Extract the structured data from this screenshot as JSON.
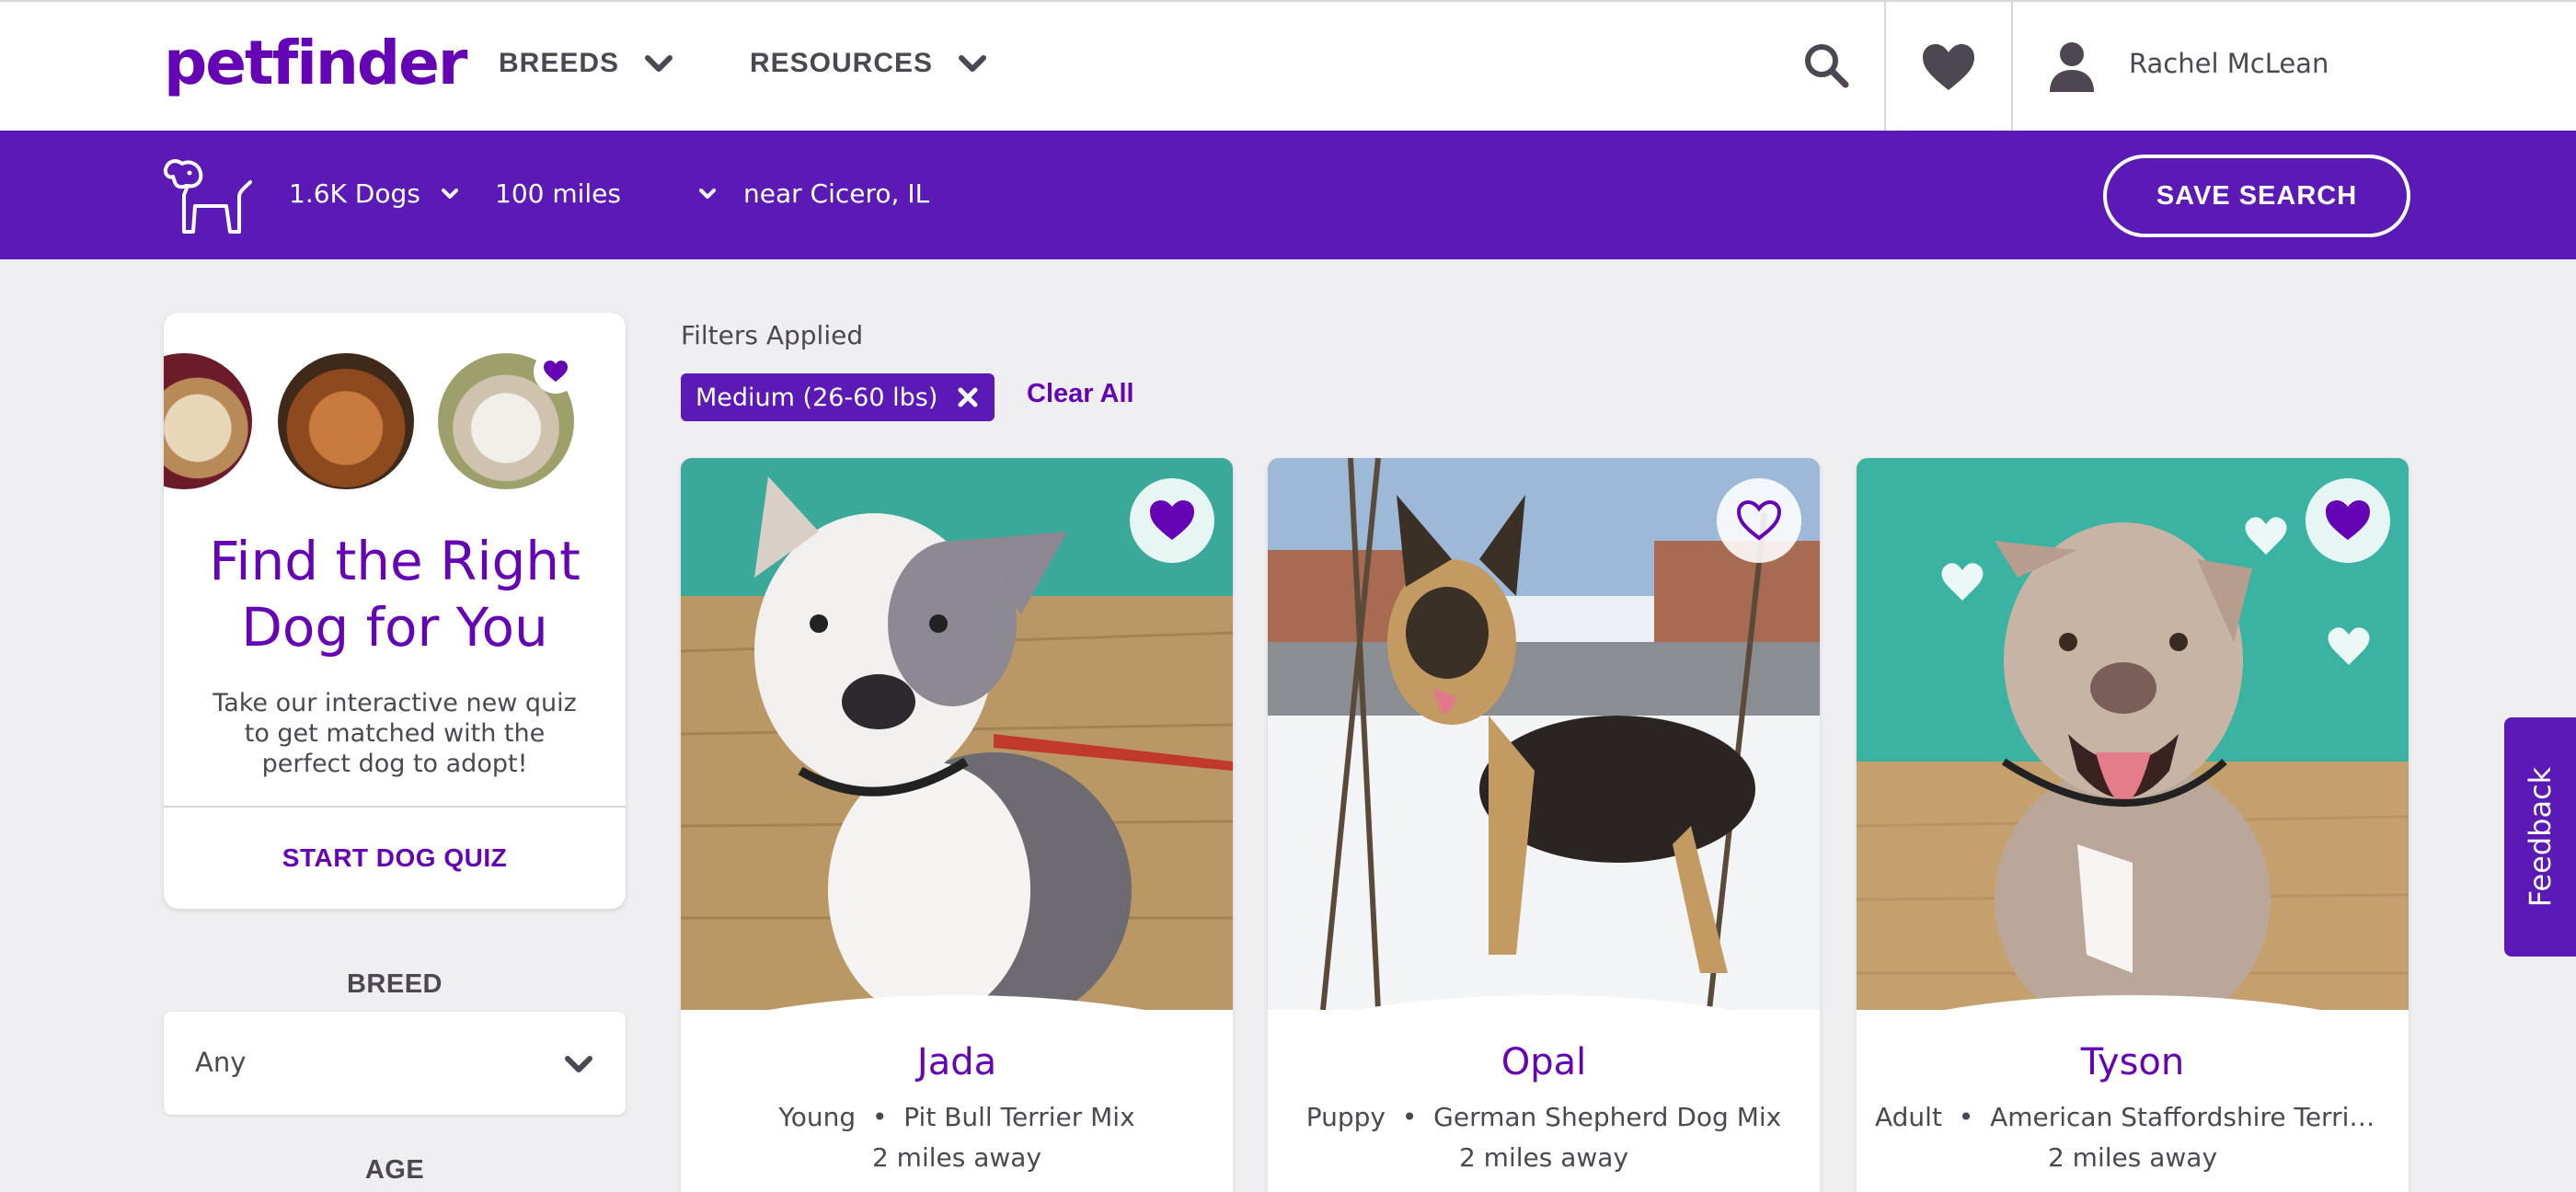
{
  "header": {
    "logo": "petfinder",
    "nav": [
      {
        "label": "BREEDS"
      },
      {
        "label": "RESOURCES"
      }
    ],
    "user_name": "Rachel McLean"
  },
  "search_bar": {
    "animal_count": "1.6K Dogs",
    "distance": "100 miles",
    "location": "near Cicero, IL",
    "save_label": "SAVE SEARCH"
  },
  "quiz": {
    "title": "Find the Right Dog for You",
    "description": "Take our interactive new quiz to get matched with the perfect dog to adopt!",
    "button": "START DOG QUIZ"
  },
  "filters": {
    "heading": "Filters Applied",
    "chips": [
      {
        "label": "Medium (26-60 lbs)"
      }
    ],
    "clear_all": "Clear All",
    "breed_label": "BREED",
    "breed_value": "Any",
    "age_label": "AGE"
  },
  "pets": [
    {
      "name": "Jada",
      "age": "Young",
      "breed": "Pit Bull Terrier Mix",
      "distance": "2 miles away",
      "favorited": true
    },
    {
      "name": "Opal",
      "age": "Puppy",
      "breed": "German Shepherd Dog Mix",
      "distance": "2 miles away",
      "favorited": false
    },
    {
      "name": "Tyson",
      "age": "Adult",
      "breed": "American Staffordshire Terrier Mix",
      "distance": "2 miles away",
      "favorited": true
    }
  ],
  "feedback_label": "Feedback",
  "colors": {
    "brand_purple": "#6504b5",
    "bar_purple": "#5b19b5",
    "text_gray": "#4d4751",
    "background": "#efeff2"
  },
  "icons": [
    "search-icon",
    "heart-icon",
    "user-icon",
    "dog-outline-icon",
    "chevron-down-icon",
    "close-icon"
  ]
}
